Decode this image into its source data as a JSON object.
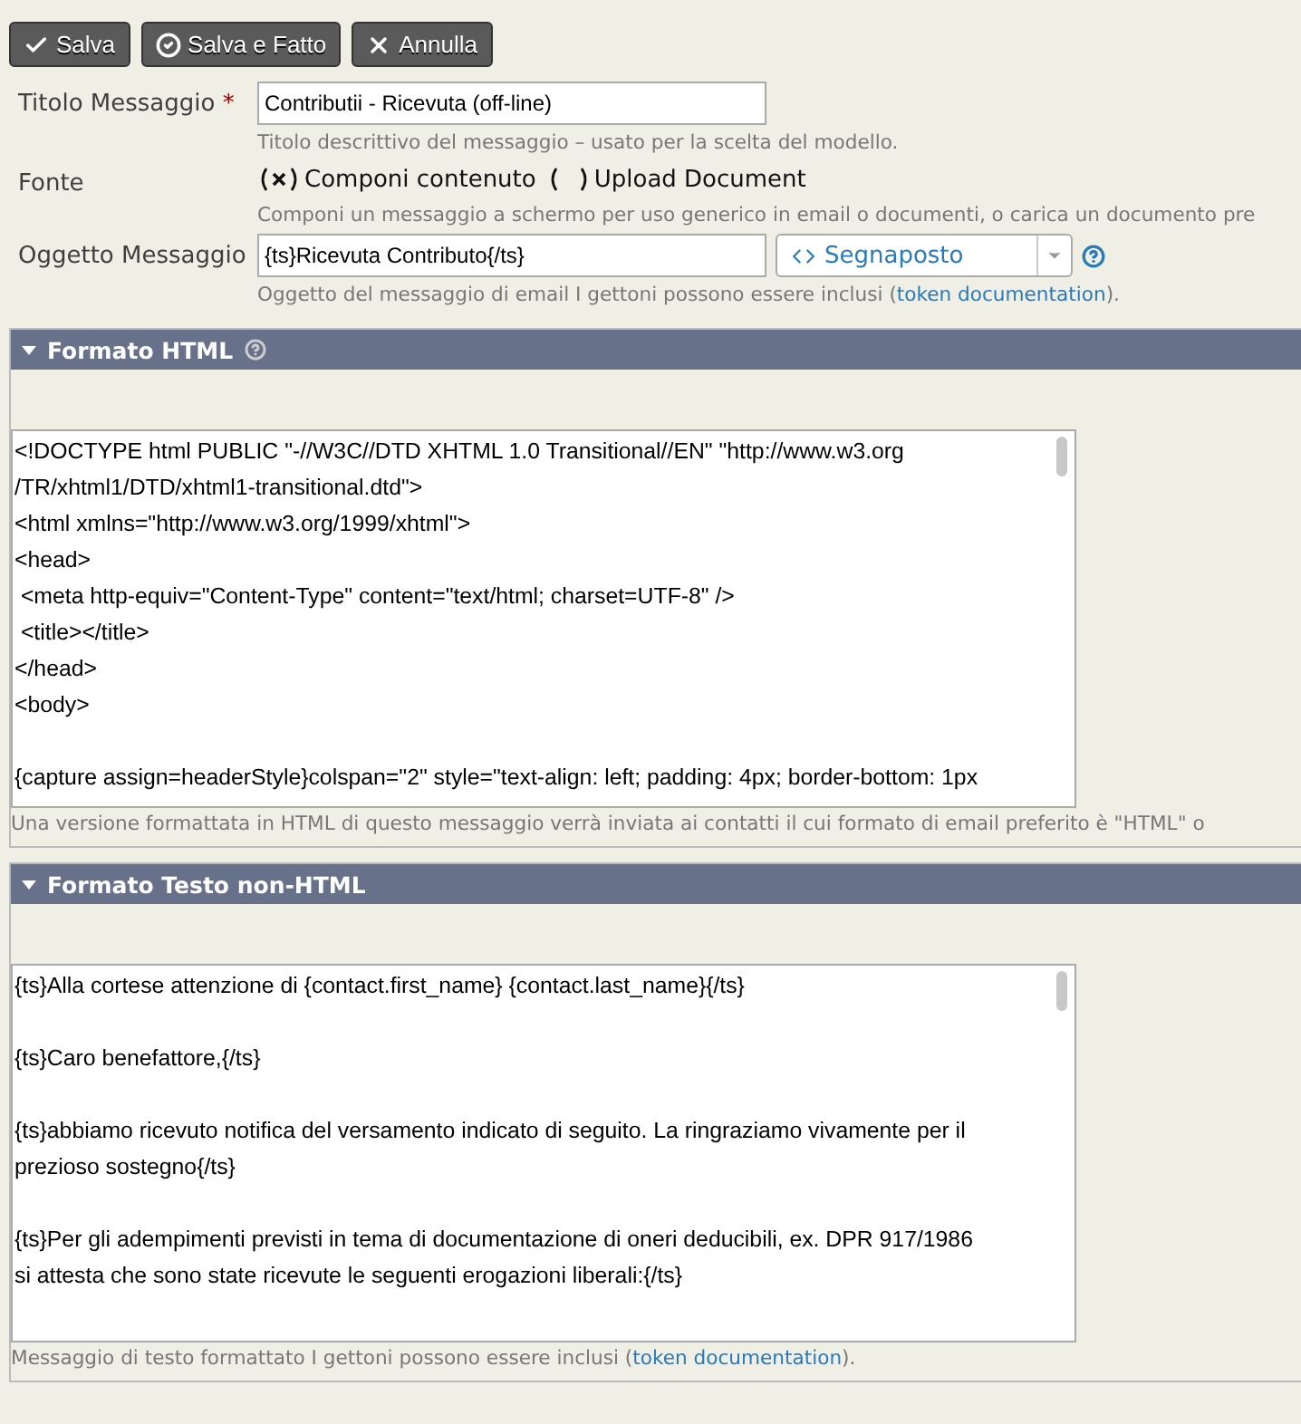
{
  "toolbar": {
    "buttons": [
      {
        "label": "Salva"
      },
      {
        "label": "Salva e Fatto"
      },
      {
        "label": "Annulla"
      }
    ]
  },
  "form": {
    "title": {
      "label": "Titolo Messaggio",
      "required_mark": "*",
      "value": "Contributii - Ricevuta (off-line)",
      "help": "Titolo descrittivo del messaggio – usato per la scelta del modello."
    },
    "source": {
      "label": "Fonte",
      "options": [
        {
          "label": "Componi contenuto",
          "selected": true
        },
        {
          "label": "Upload Document",
          "selected": false
        }
      ],
      "help": "Componi un messaggio a schermo per uso generico in email o documenti, o carica un documento pre"
    },
    "subject": {
      "label": "Oggetto Messaggio",
      "value": "{ts}Ricevuta Contributo{/ts}",
      "token_select": "Segnaposto",
      "help_before": "Oggetto del messaggio di email I gettoni possono essere inclusi (",
      "help_link": "token documentation",
      "help_after": ")."
    }
  },
  "sections": [
    {
      "title": "Formato HTML",
      "help_icon": true,
      "expanded": true,
      "paragraphs": [
        [
          "<!DOCTYPE html PUBLIC \"-//W3C//DTD XHTML 1.0 Transitional//EN\" \"http://www.w3.org",
          "/TR/xhtml1/DTD/xhtml1-transitional.dtd\">",
          "<html xmlns=\"http://www.w3.org/1999/xhtml\">",
          "<head>",
          " <meta http-equiv=\"Content-Type\" content=\"text/html; charset=UTF-8\" />",
          " <title></title>",
          "</head>",
          "<body>"
        ],
        [
          "{capture assign=headerStyle}colspan=\"2\" style=\"text-align: left; padding: 4px; border-bottom: 1px"
        ]
      ],
      "help_before": "Una versione formattata in HTML di questo messaggio verrà inviata ai contatti il cui formato di email preferito è \"HTML\" o"
    },
    {
      "title": "Formato Testo non-HTML",
      "help_icon": false,
      "expanded": true,
      "paragraphs": [
        [
          "{ts}Alla cortese attenzione di {contact.first_name} {contact.last_name}{/ts}"
        ],
        [
          "{ts}Caro benefattore,{/ts}"
        ],
        [
          "{ts}abbiamo ricevuto notifica del versamento indicato di seguito. La ringraziamo vivamente per il",
          "prezioso sostegno{/ts}"
        ],
        [
          "{ts}Per gli adempimenti previsti in tema di documentazione di oneri deducibili, ex. DPR 917/1986",
          "si attesta che sono state ricevute le seguenti erogazioni liberali:{/ts}"
        ]
      ],
      "help_before": "Messaggio di testo formattato I gettoni possono essere inclusi (",
      "help_link": "token documentation",
      "help_after": ")."
    }
  ]
}
